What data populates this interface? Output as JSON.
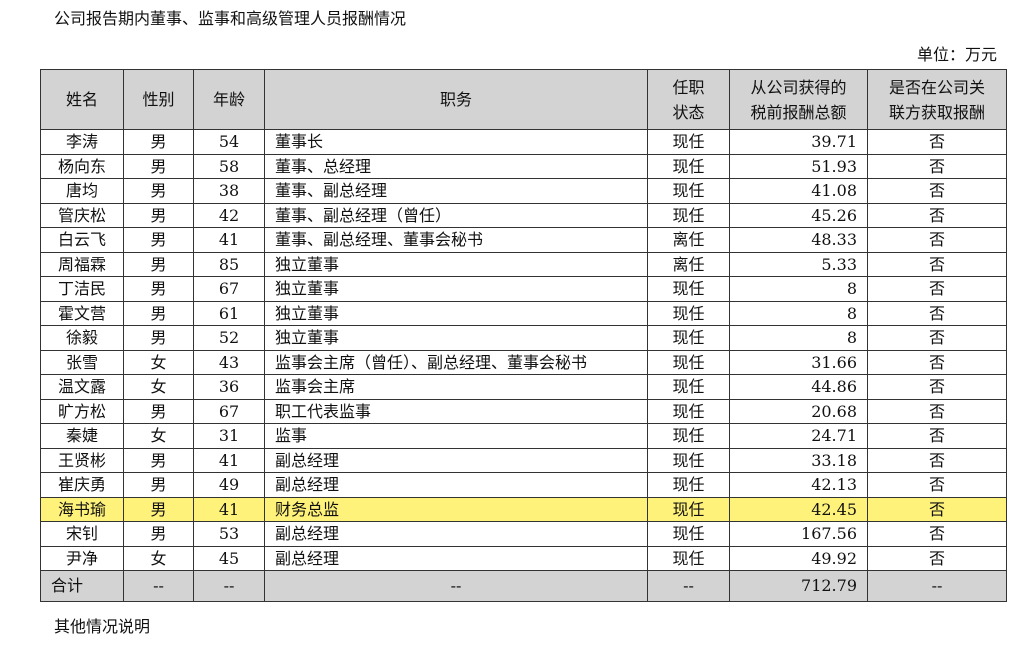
{
  "caption": "公司报告期内董事、监事和高级管理人员报酬情况",
  "unit": "单位：万元",
  "headers": {
    "name": "姓名",
    "gender": "性别",
    "age": "年龄",
    "position": "职务",
    "status_l1": "任职",
    "status_l2": "状态",
    "pay_l1": "从公司获得的",
    "pay_l2": "税前报酬总额",
    "related_l1": "是否在公司关",
    "related_l2": "联方获取报酬"
  },
  "rows": [
    {
      "name": "李涛",
      "gender": "男",
      "age": "54",
      "position": "董事长",
      "status": "现任",
      "pay": "39.71",
      "related": "否"
    },
    {
      "name": "杨向东",
      "gender": "男",
      "age": "58",
      "position": "董事、总经理",
      "status": "现任",
      "pay": "51.93",
      "related": "否"
    },
    {
      "name": "唐均",
      "gender": "男",
      "age": "38",
      "position": "董事、副总经理",
      "status": "现任",
      "pay": "41.08",
      "related": "否"
    },
    {
      "name": "管庆松",
      "gender": "男",
      "age": "42",
      "position": "董事、副总经理（曾任）",
      "status": "现任",
      "pay": "45.26",
      "related": "否"
    },
    {
      "name": "白云飞",
      "gender": "男",
      "age": "41",
      "position": "董事、副总经理、董事会秘书",
      "status": "离任",
      "pay": "48.33",
      "related": "否"
    },
    {
      "name": "周福霖",
      "gender": "男",
      "age": "85",
      "position": "独立董事",
      "status": "离任",
      "pay": "5.33",
      "related": "否"
    },
    {
      "name": "丁洁民",
      "gender": "男",
      "age": "67",
      "position": "独立董事",
      "status": "现任",
      "pay": "8",
      "related": "否"
    },
    {
      "name": "霍文营",
      "gender": "男",
      "age": "61",
      "position": "独立董事",
      "status": "现任",
      "pay": "8",
      "related": "否"
    },
    {
      "name": "徐毅",
      "gender": "男",
      "age": "52",
      "position": "独立董事",
      "status": "现任",
      "pay": "8",
      "related": "否"
    },
    {
      "name": "张雪",
      "gender": "女",
      "age": "43",
      "position": "监事会主席（曾任）、副总经理、董事会秘书",
      "status": "现任",
      "pay": "31.66",
      "related": "否"
    },
    {
      "name": "温文露",
      "gender": "女",
      "age": "36",
      "position": "监事会主席",
      "status": "现任",
      "pay": "44.86",
      "related": "否"
    },
    {
      "name": "旷方松",
      "gender": "男",
      "age": "67",
      "position": "职工代表监事",
      "status": "现任",
      "pay": "20.68",
      "related": "否"
    },
    {
      "name": "秦婕",
      "gender": "女",
      "age": "31",
      "position": "监事",
      "status": "现任",
      "pay": "24.71",
      "related": "否"
    },
    {
      "name": "王贤彬",
      "gender": "男",
      "age": "41",
      "position": "副总经理",
      "status": "现任",
      "pay": "33.18",
      "related": "否"
    },
    {
      "name": "崔庆勇",
      "gender": "男",
      "age": "49",
      "position": "副总经理",
      "status": "现任",
      "pay": "42.13",
      "related": "否"
    },
    {
      "name": "海书瑜",
      "gender": "男",
      "age": "41",
      "position": "财务总监",
      "status": "现任",
      "pay": "42.45",
      "related": "否",
      "highlight": true
    },
    {
      "name": "宋钊",
      "gender": "男",
      "age": "53",
      "position": "副总经理",
      "status": "现任",
      "pay": "167.56",
      "related": "否"
    },
    {
      "name": "尹净",
      "gender": "女",
      "age": "45",
      "position": "副总经理",
      "status": "现任",
      "pay": "49.92",
      "related": "否"
    }
  ],
  "total": {
    "label": "合计",
    "gender": "--",
    "age": "--",
    "position": "--",
    "status": "--",
    "pay": "712.79",
    "related": "--"
  },
  "note": "其他情况说明",
  "colors": {
    "header_bg": "#d3d3d3",
    "highlight_bg": "#fff27a",
    "border": "#333333"
  }
}
